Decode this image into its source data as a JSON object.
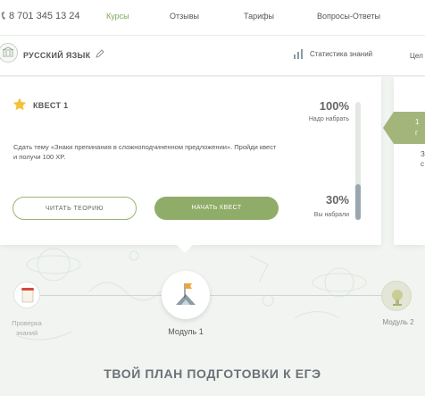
{
  "topnav": {
    "phone": "8 701 345 13 24",
    "links": [
      {
        "label": "Курсы",
        "active": true
      },
      {
        "label": "Отзывы",
        "active": false
      },
      {
        "label": "Тарифы",
        "active": false
      },
      {
        "label": "Вопросы-Ответы",
        "active": false
      }
    ]
  },
  "subject": {
    "title": "РУССКИЙ ЯЗЫК",
    "stats_label": "Статистика знаний",
    "goals_label": "Цел"
  },
  "quest": {
    "title": "КВЕСТ 1",
    "need_percent": "100%",
    "need_label": "Надо набрать",
    "description": "Сдать тему «Знаки препинания в сложноподчиненном предложении». Пройди квест и получи 100 XP.",
    "have_percent": "30%",
    "have_label": "Вы набрали",
    "progress_fraction": 0.3,
    "theory_button": "ЧИТАТЬ ТЕОРИЮ",
    "start_button": "НАЧАТЬ КВЕСТ"
  },
  "side_card": {
    "tag_text": "1",
    "tag_sub": "г",
    "line1": "З",
    "line2": "с"
  },
  "timeline": {
    "check_label_line1": "Проверка",
    "check_label_line2": "знаний",
    "module1_label": "Модуль 1",
    "module2_label": "Модуль 2"
  },
  "plan_title": "ТВОЙ ПЛАН ПОДГОТОВКИ К ЕГЭ",
  "colors": {
    "accent_green": "#8fad68",
    "active_link": "#7ca95a",
    "progress_bar": "#9aa7b1",
    "star": "#f3c23a"
  },
  "icons": [
    "phone-icon",
    "subject-logo-icon",
    "pencil-icon",
    "stats-icon",
    "star-icon",
    "scroll-icon",
    "flag-icon",
    "trophy-icon"
  ]
}
